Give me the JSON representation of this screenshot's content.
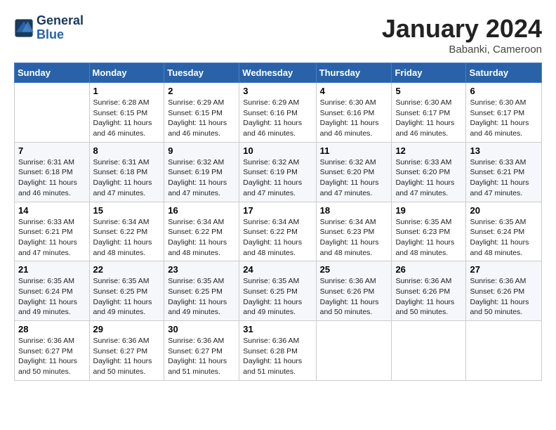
{
  "header": {
    "logo_line1": "General",
    "logo_line2": "Blue",
    "month_title": "January 2024",
    "location": "Babanki, Cameroon"
  },
  "weekdays": [
    "Sunday",
    "Monday",
    "Tuesday",
    "Wednesday",
    "Thursday",
    "Friday",
    "Saturday"
  ],
  "weeks": [
    [
      {
        "day": "",
        "text": ""
      },
      {
        "day": "1",
        "text": "Sunrise: 6:28 AM\nSunset: 6:15 PM\nDaylight: 11 hours\nand 46 minutes."
      },
      {
        "day": "2",
        "text": "Sunrise: 6:29 AM\nSunset: 6:15 PM\nDaylight: 11 hours\nand 46 minutes."
      },
      {
        "day": "3",
        "text": "Sunrise: 6:29 AM\nSunset: 6:16 PM\nDaylight: 11 hours\nand 46 minutes."
      },
      {
        "day": "4",
        "text": "Sunrise: 6:30 AM\nSunset: 6:16 PM\nDaylight: 11 hours\nand 46 minutes."
      },
      {
        "day": "5",
        "text": "Sunrise: 6:30 AM\nSunset: 6:17 PM\nDaylight: 11 hours\nand 46 minutes."
      },
      {
        "day": "6",
        "text": "Sunrise: 6:30 AM\nSunset: 6:17 PM\nDaylight: 11 hours\nand 46 minutes."
      }
    ],
    [
      {
        "day": "7",
        "text": "Sunrise: 6:31 AM\nSunset: 6:18 PM\nDaylight: 11 hours\nand 46 minutes."
      },
      {
        "day": "8",
        "text": "Sunrise: 6:31 AM\nSunset: 6:18 PM\nDaylight: 11 hours\nand 47 minutes."
      },
      {
        "day": "9",
        "text": "Sunrise: 6:32 AM\nSunset: 6:19 PM\nDaylight: 11 hours\nand 47 minutes."
      },
      {
        "day": "10",
        "text": "Sunrise: 6:32 AM\nSunset: 6:19 PM\nDaylight: 11 hours\nand 47 minutes."
      },
      {
        "day": "11",
        "text": "Sunrise: 6:32 AM\nSunset: 6:20 PM\nDaylight: 11 hours\nand 47 minutes."
      },
      {
        "day": "12",
        "text": "Sunrise: 6:33 AM\nSunset: 6:20 PM\nDaylight: 11 hours\nand 47 minutes."
      },
      {
        "day": "13",
        "text": "Sunrise: 6:33 AM\nSunset: 6:21 PM\nDaylight: 11 hours\nand 47 minutes."
      }
    ],
    [
      {
        "day": "14",
        "text": "Sunrise: 6:33 AM\nSunset: 6:21 PM\nDaylight: 11 hours\nand 47 minutes."
      },
      {
        "day": "15",
        "text": "Sunrise: 6:34 AM\nSunset: 6:22 PM\nDaylight: 11 hours\nand 48 minutes."
      },
      {
        "day": "16",
        "text": "Sunrise: 6:34 AM\nSunset: 6:22 PM\nDaylight: 11 hours\nand 48 minutes."
      },
      {
        "day": "17",
        "text": "Sunrise: 6:34 AM\nSunset: 6:22 PM\nDaylight: 11 hours\nand 48 minutes."
      },
      {
        "day": "18",
        "text": "Sunrise: 6:34 AM\nSunset: 6:23 PM\nDaylight: 11 hours\nand 48 minutes."
      },
      {
        "day": "19",
        "text": "Sunrise: 6:35 AM\nSunset: 6:23 PM\nDaylight: 11 hours\nand 48 minutes."
      },
      {
        "day": "20",
        "text": "Sunrise: 6:35 AM\nSunset: 6:24 PM\nDaylight: 11 hours\nand 48 minutes."
      }
    ],
    [
      {
        "day": "21",
        "text": "Sunrise: 6:35 AM\nSunset: 6:24 PM\nDaylight: 11 hours\nand 49 minutes."
      },
      {
        "day": "22",
        "text": "Sunrise: 6:35 AM\nSunset: 6:25 PM\nDaylight: 11 hours\nand 49 minutes."
      },
      {
        "day": "23",
        "text": "Sunrise: 6:35 AM\nSunset: 6:25 PM\nDaylight: 11 hours\nand 49 minutes."
      },
      {
        "day": "24",
        "text": "Sunrise: 6:35 AM\nSunset: 6:25 PM\nDaylight: 11 hours\nand 49 minutes."
      },
      {
        "day": "25",
        "text": "Sunrise: 6:36 AM\nSunset: 6:26 PM\nDaylight: 11 hours\nand 50 minutes."
      },
      {
        "day": "26",
        "text": "Sunrise: 6:36 AM\nSunset: 6:26 PM\nDaylight: 11 hours\nand 50 minutes."
      },
      {
        "day": "27",
        "text": "Sunrise: 6:36 AM\nSunset: 6:26 PM\nDaylight: 11 hours\nand 50 minutes."
      }
    ],
    [
      {
        "day": "28",
        "text": "Sunrise: 6:36 AM\nSunset: 6:27 PM\nDaylight: 11 hours\nand 50 minutes."
      },
      {
        "day": "29",
        "text": "Sunrise: 6:36 AM\nSunset: 6:27 PM\nDaylight: 11 hours\nand 50 minutes."
      },
      {
        "day": "30",
        "text": "Sunrise: 6:36 AM\nSunset: 6:27 PM\nDaylight: 11 hours\nand 51 minutes."
      },
      {
        "day": "31",
        "text": "Sunrise: 6:36 AM\nSunset: 6:28 PM\nDaylight: 11 hours\nand 51 minutes."
      },
      {
        "day": "",
        "text": ""
      },
      {
        "day": "",
        "text": ""
      },
      {
        "day": "",
        "text": ""
      }
    ]
  ]
}
